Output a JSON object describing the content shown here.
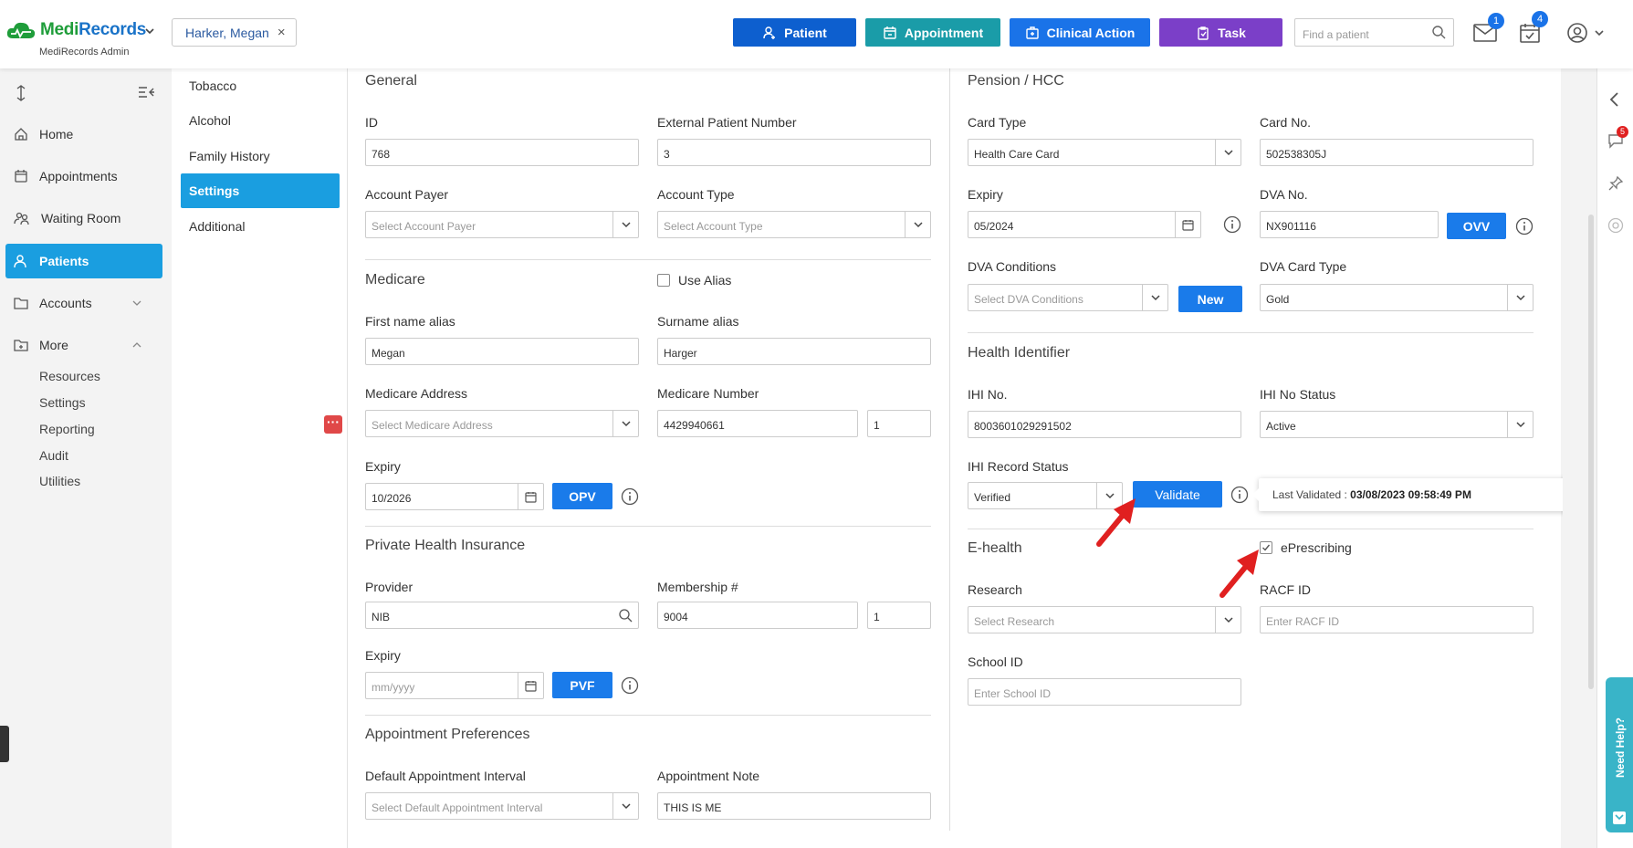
{
  "header": {
    "logo": {
      "medi": "Medi",
      "records": "Records",
      "sub": "MediRecords Admin"
    },
    "patient_chip": "Harker, Megan",
    "buttons": [
      {
        "label": "Patient",
        "color": "#0d5fcf"
      },
      {
        "label": "Appointment",
        "color": "#1a9ca8"
      },
      {
        "label": "Clinical Action",
        "color": "#1a73e8"
      },
      {
        "label": "Task",
        "color": "#7b3fc8"
      }
    ],
    "search_placeholder": "Find a patient",
    "mail_badge": "1",
    "task_badge": "4"
  },
  "sidebar": {
    "items": [
      {
        "label": "Home",
        "icon": "home-icon"
      },
      {
        "label": "Appointments",
        "icon": "calendar-icon"
      },
      {
        "label": "Waiting Room",
        "icon": "users-icon"
      },
      {
        "label": "Patients",
        "icon": "user-icon"
      },
      {
        "label": "Accounts",
        "icon": "folder-icon"
      },
      {
        "label": "More",
        "icon": "folder-plus-icon"
      }
    ],
    "subitems": [
      "Resources",
      "Settings",
      "Reporting",
      "Audit",
      "Utilities"
    ]
  },
  "subnav": [
    "Tobacco",
    "Alcohol",
    "Family History",
    "Settings",
    "Additional"
  ],
  "left": {
    "general": "General",
    "id_label": "ID",
    "id_value": "768",
    "ext_label": "External Patient Number",
    "ext_value": "3",
    "payer_label": "Account Payer",
    "payer_ph": "Select Account Payer",
    "type_label": "Account Type",
    "type_ph": "Select Account Type",
    "medicare": "Medicare",
    "use_alias": "Use Alias",
    "fname_label": "First name alias",
    "fname_value": "Megan",
    "sname_label": "Surname alias",
    "sname_value": "Harger",
    "maddr_label": "Medicare Address",
    "maddr_ph": "Select Medicare Address",
    "mnum_label": "Medicare Number",
    "mnum_value": "4429940661",
    "mnum_irn": "1",
    "mexp_label": "Expiry",
    "mexp_value": "10/2026",
    "opv": "OPV",
    "phi": "Private Health Insurance",
    "provider_label": "Provider",
    "provider_value": "NIB",
    "member_label": "Membership #",
    "member_value": "9004",
    "member_sub": "1",
    "pexp_label": "Expiry",
    "pexp_ph": "mm/yyyy",
    "pvf": "PVF",
    "appt_pref": "Appointment Preferences",
    "interval_label": "Default Appointment Interval",
    "interval_ph": "Select Default Appointment Interval",
    "note_label": "Appointment Note",
    "note_value": "THIS IS ME"
  },
  "right": {
    "pension": "Pension / HCC",
    "ctype_label": "Card Type",
    "ctype_value": "Health Care Card",
    "cno_label": "Card No.",
    "cno_value": "502538305J",
    "exp_label": "Expiry",
    "exp_value": "05/2024",
    "dva_label": "DVA No.",
    "dva_value": "NX901116",
    "ovv": "OVV",
    "dvac_label": "DVA Conditions",
    "dvac_ph": "Select DVA Conditions",
    "new": "New",
    "dvat_label": "DVA Card Type",
    "dvat_value": "Gold",
    "hi": "Health Identifier",
    "ihi_label": "IHI No.",
    "ihi_value": "8003601029291502",
    "ihis_label": "IHI No Status",
    "ihis_value": "Active",
    "ihir_label": "IHI Record Status",
    "ihir_value": "Verified",
    "validate": "Validate",
    "tooltip_label": "Last Validated : ",
    "tooltip_value": "03/08/2023 09:58:49 PM",
    "ehealth": "E-health",
    "eprescribing": "ePrescribing",
    "research_label": "Research",
    "research_ph": "Select Research",
    "racf_label": "RACF ID",
    "racf_ph": "Enter RACF ID",
    "school_label": "School ID",
    "school_ph": "Enter School ID"
  },
  "rightbar": {
    "chat_badge": "5",
    "help": "Need Help?"
  }
}
